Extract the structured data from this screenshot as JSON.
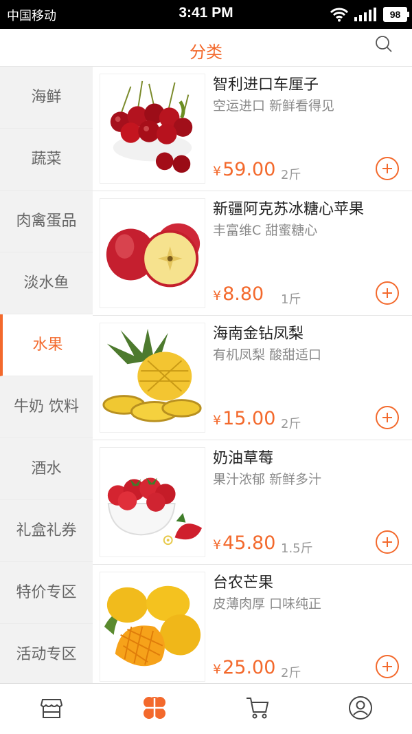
{
  "status_bar": {
    "carrier": "中国移动",
    "time": "3:41 PM",
    "battery": "98"
  },
  "header": {
    "title": "分类",
    "search_icon": "search-icon"
  },
  "sidebar": {
    "items": [
      {
        "label": "海鲜",
        "active": false
      },
      {
        "label": "蔬菜",
        "active": false
      },
      {
        "label": "肉禽蛋品",
        "active": false
      },
      {
        "label": "淡水鱼",
        "active": false
      },
      {
        "label": "水果",
        "active": true
      },
      {
        "label": "牛奶 饮料",
        "active": false
      },
      {
        "label": "酒水",
        "active": false
      },
      {
        "label": "礼盒礼券",
        "active": false
      },
      {
        "label": "特价专区",
        "active": false
      },
      {
        "label": "活动专区",
        "active": false
      }
    ]
  },
  "products": [
    {
      "name": "智利进口车厘子",
      "desc": "空运进口  新鲜看得见",
      "currency": "¥",
      "price": "59.00",
      "unit": "2斤",
      "image": "cherries"
    },
    {
      "name": "新疆阿克苏冰糖心苹果",
      "desc": "丰富维C  甜蜜糖心",
      "currency": "¥",
      "price": "8.80",
      "unit": "1斤",
      "image": "apples"
    },
    {
      "name": "海南金钻凤梨",
      "desc": "有机凤梨  酸甜适口",
      "currency": "¥",
      "price": "15.00",
      "unit": "2斤",
      "image": "pineapple"
    },
    {
      "name": "奶油草莓",
      "desc": "果汁浓郁  新鲜多汁",
      "currency": "¥",
      "price": "45.80",
      "unit": "1.5斤",
      "image": "strawberries"
    },
    {
      "name": "台农芒果",
      "desc": "皮薄肉厚  口味纯正",
      "currency": "¥",
      "price": "25.00",
      "unit": "2斤",
      "image": "mangoes"
    }
  ],
  "tabbar": {
    "tabs": [
      {
        "icon": "store-icon",
        "active": false
      },
      {
        "icon": "category-icon",
        "active": true
      },
      {
        "icon": "cart-icon",
        "active": false
      },
      {
        "icon": "user-icon",
        "active": false
      }
    ]
  },
  "colors": {
    "accent": "#f3692c",
    "muted_text": "#8a8a8a",
    "sidebar_bg": "#f2f2f2"
  }
}
